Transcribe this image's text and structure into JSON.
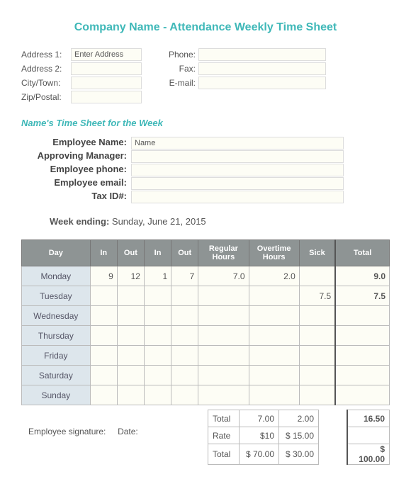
{
  "title": "Company Name - Attendance Weekly Time Sheet",
  "contact": {
    "addr1_lbl": "Address 1:",
    "addr1_val": "Enter Address",
    "addr2_lbl": "Address 2:",
    "addr2_val": "",
    "city_lbl": "City/Town:",
    "city_val": "",
    "zip_lbl": "Zip/Postal:",
    "zip_val": "",
    "phone_lbl": "Phone:",
    "phone_val": "",
    "fax_lbl": "Fax:",
    "fax_val": "",
    "email_lbl": "E-mail:",
    "email_val": ""
  },
  "subtitle": "Name's Time Sheet for the Week",
  "emp": {
    "name_lbl": "Employee Name:",
    "name_val": "Name",
    "mgr_lbl": "Approving Manager:",
    "mgr_val": "",
    "phone_lbl": "Employee phone:",
    "phone_val": "",
    "email_lbl": "Employee email:",
    "email_val": "",
    "tax_lbl": "Tax ID#:",
    "tax_val": ""
  },
  "week": {
    "lbl": "Week ending:",
    "val": "Sunday, June 21, 2015"
  },
  "headers": {
    "day": "Day",
    "in": "In",
    "out": "Out",
    "in2": "In",
    "out2": "Out",
    "reg": "Regular Hours",
    "ot": "Overtime Hours",
    "sick": "Sick",
    "total": "Total"
  },
  "rows": [
    {
      "day": "Monday",
      "in": "9",
      "out": "12",
      "in2": "1",
      "out2": "7",
      "reg": "7.0",
      "ot": "2.0",
      "sick": "",
      "total": "9.0"
    },
    {
      "day": "Tuesday",
      "in": "",
      "out": "",
      "in2": "",
      "out2": "",
      "reg": "",
      "ot": "",
      "sick": "7.5",
      "total": "7.5"
    },
    {
      "day": "Wednesday",
      "in": "",
      "out": "",
      "in2": "",
      "out2": "",
      "reg": "",
      "ot": "",
      "sick": "",
      "total": ""
    },
    {
      "day": "Thursday",
      "in": "",
      "out": "",
      "in2": "",
      "out2": "",
      "reg": "",
      "ot": "",
      "sick": "",
      "total": ""
    },
    {
      "day": "Friday",
      "in": "",
      "out": "",
      "in2": "",
      "out2": "",
      "reg": "",
      "ot": "",
      "sick": "",
      "total": ""
    },
    {
      "day": "Saturday",
      "in": "",
      "out": "",
      "in2": "",
      "out2": "",
      "reg": "",
      "ot": "",
      "sick": "",
      "total": ""
    },
    {
      "day": "Sunday",
      "in": "",
      "out": "",
      "in2": "",
      "out2": "",
      "reg": "",
      "ot": "",
      "sick": "",
      "total": ""
    }
  ],
  "summary": {
    "total_lbl": "Total",
    "rate_lbl": "Rate",
    "grand_lbl": "Total",
    "total_reg": "7.00",
    "total_ot": "2.00",
    "total_all": "16.50",
    "rate_reg": "$10",
    "rate_ot": "$   15.00",
    "grand_reg": "$   70.00",
    "grand_ot": "$   30.00",
    "grand_all": "$   100.00"
  },
  "sig": {
    "emp": "Employee signature:",
    "date": "Date:"
  }
}
